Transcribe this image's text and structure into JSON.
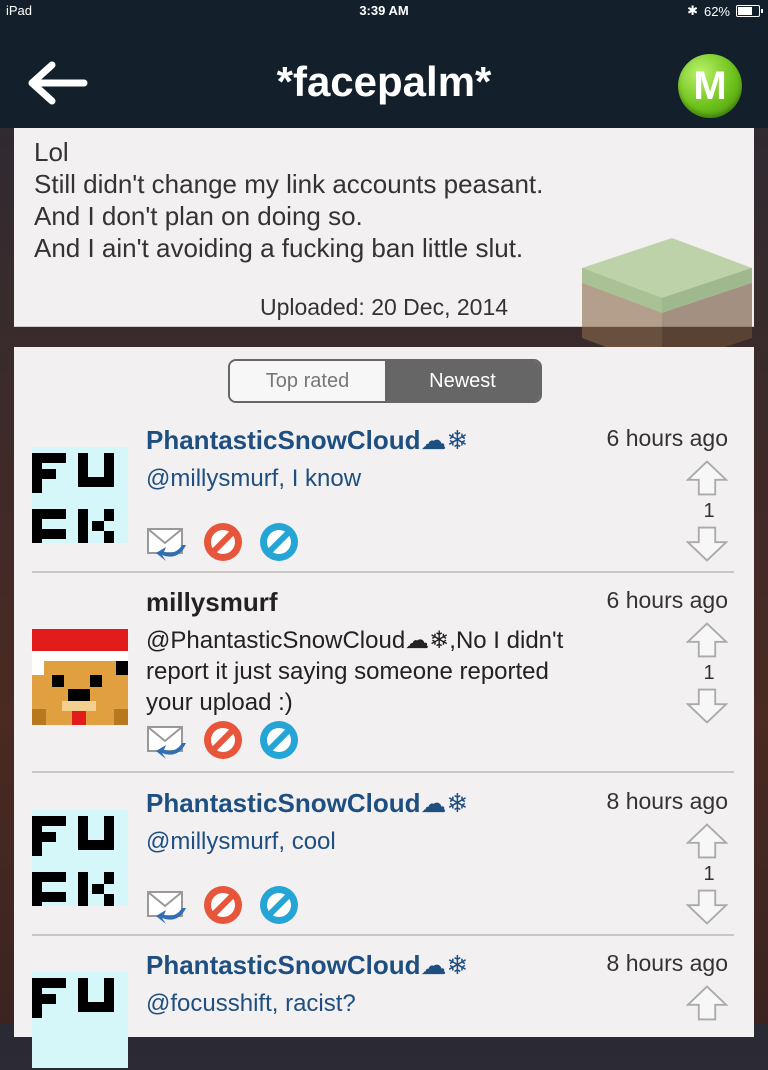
{
  "status": {
    "device": "iPad",
    "time": "3:39 AM",
    "battery": "62%"
  },
  "nav": {
    "title": "*facepalm*",
    "logo_letter": "M"
  },
  "post": {
    "lines": [
      "Lol",
      "Still didn't change my link accounts peasant.",
      "And I don't plan on doing so.",
      "And I ain't avoiding a fucking ban little slut."
    ],
    "uploaded": "Uploaded: 20 Dec, 2014"
  },
  "sort": {
    "top_rated": "Top rated",
    "newest": "Newest",
    "selected": "Newest"
  },
  "comments": [
    {
      "user": "PhantasticSnowCloud",
      "time": "6 hours ago",
      "text": "@millysmurf, I know",
      "votes": "1",
      "avatar": "fuck-avatar",
      "style": "blue"
    },
    {
      "user": "millysmurf",
      "time": "6 hours ago",
      "text_lines": [
        "@PhantasticSnowCloud☁❄,No I didn't",
        "report it just saying someone reported",
        "your upload :)"
      ],
      "votes": "1",
      "avatar": "santa-dog-avatar",
      "style": "dark"
    },
    {
      "user": "PhantasticSnowCloud",
      "time": "8 hours ago",
      "text": "@millysmurf, cool",
      "votes": "1",
      "avatar": "fuck-avatar",
      "style": "blue"
    },
    {
      "user": "PhantasticSnowCloud",
      "time": "8 hours ago",
      "text": "@focusshift, racist?",
      "votes": "",
      "avatar": "fuck-avatar",
      "style": "blue"
    }
  ],
  "user_suffix": "☁❄"
}
